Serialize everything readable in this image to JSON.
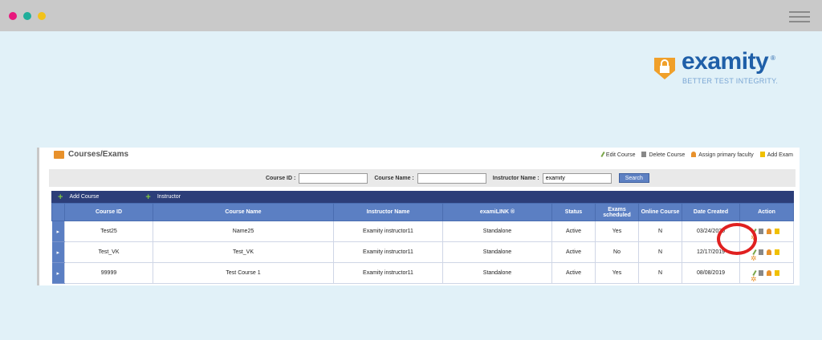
{
  "window": {
    "dots": [
      "#e8187d",
      "#1fae9a",
      "#f2c21a"
    ]
  },
  "logo": {
    "wordmark": "examity",
    "registered": "®",
    "tagline": "BETTER TEST INTEGRITY."
  },
  "page": {
    "title": "Courses/Exams",
    "legend": [
      {
        "icon": "pencil-icon",
        "label": "Edit Course"
      },
      {
        "icon": "trash-icon",
        "label": "Delete Course"
      },
      {
        "icon": "person-icon",
        "label": "Assign primary faculty"
      },
      {
        "icon": "document-icon",
        "label": "Add Exam"
      }
    ]
  },
  "search": {
    "course_id_label": "Course ID :",
    "course_id_value": "",
    "course_name_label": "Course Name :",
    "course_name_value": "",
    "instructor_label": "Instructor Name :",
    "instructor_value": "examity",
    "button": "Search"
  },
  "toolbar": {
    "add_course": "Add Course",
    "instructor": "Instructor"
  },
  "table": {
    "headers": [
      "Course ID",
      "Course Name",
      "Instructor Name",
      "examiLINK ®",
      "Status",
      "Exams scheduled",
      "Online Course",
      "Date Created",
      "Action"
    ],
    "rows": [
      [
        "Test25",
        "Name25",
        "Examity instructor11",
        "Standalone",
        "Active",
        "Yes",
        "N",
        "03/24/2020"
      ],
      [
        "Test_VK",
        "Test_VK",
        "Examity instructor11",
        "Standalone",
        "Active",
        "No",
        "N",
        "12/17/2019"
      ],
      [
        "99999",
        "Test Course 1",
        "Examity instructor11",
        "Standalone",
        "Active",
        "Yes",
        "N",
        "08/08/2019"
      ]
    ]
  },
  "colors": {
    "highlight_circle": "#e02020",
    "header_bar": "#2c3e79",
    "header_row": "#5b7fc3"
  }
}
